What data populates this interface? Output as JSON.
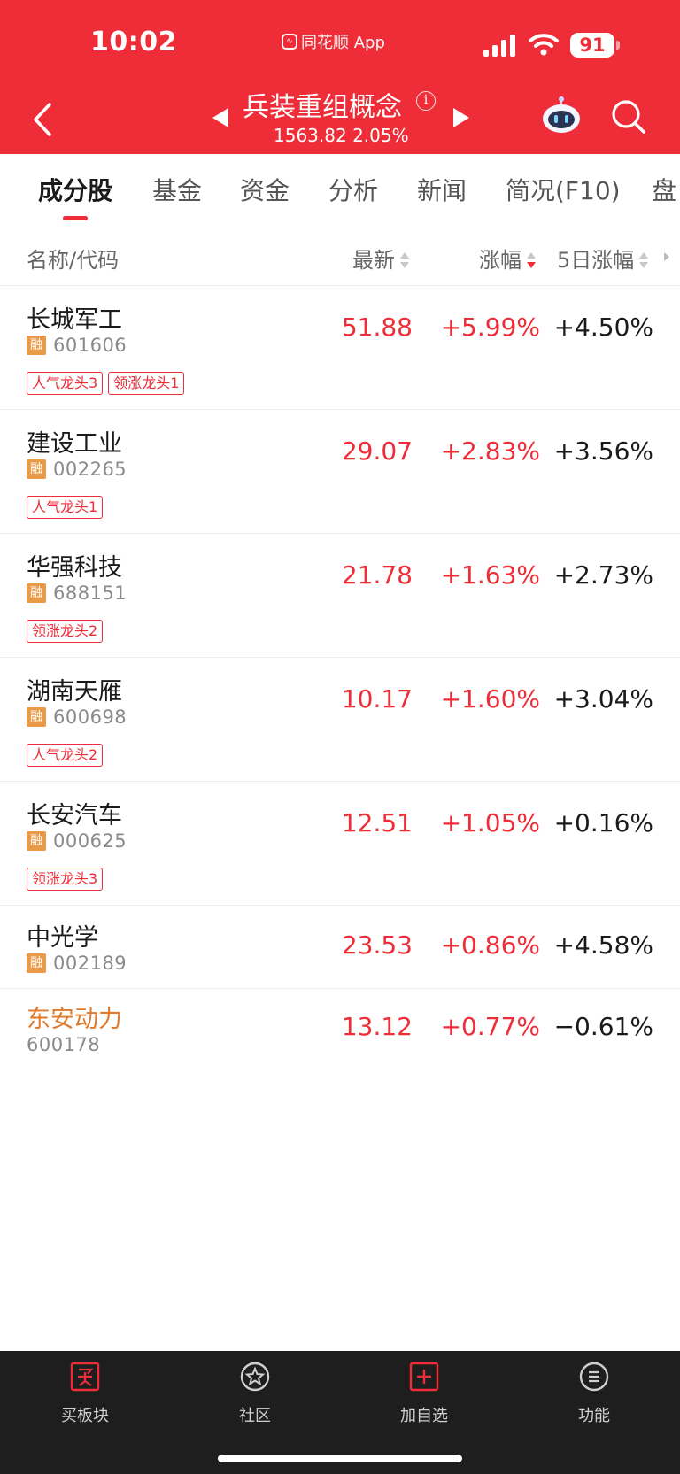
{
  "status_bar": {
    "time": "10:02",
    "app_label": "同花顺 App",
    "battery": "91"
  },
  "header": {
    "title": "兵装重组概念",
    "subtitle": "1563.82 2.05%"
  },
  "tabs": [
    "成分股",
    "基金",
    "资金",
    "分析",
    "新闻",
    "简况(F10)",
    "盘"
  ],
  "columns": {
    "name": "名称/代码",
    "price": "最新",
    "change": "涨幅",
    "change5d": "5日涨幅"
  },
  "rows": [
    {
      "name": "长城军工",
      "code": "601606",
      "rong": "融",
      "price": "51.88",
      "change": "+5.99%",
      "change5d": "+4.50%",
      "tags": [
        "人气龙头3",
        "领涨龙头1"
      ]
    },
    {
      "name": "建设工业",
      "code": "002265",
      "rong": "融",
      "price": "29.07",
      "change": "+2.83%",
      "change5d": "+3.56%",
      "tags": [
        "人气龙头1"
      ]
    },
    {
      "name": "华强科技",
      "code": "688151",
      "rong": "融",
      "price": "21.78",
      "change": "+1.63%",
      "change5d": "+2.73%",
      "tags": [
        "领涨龙头2"
      ]
    },
    {
      "name": "湖南天雁",
      "code": "600698",
      "rong": "融",
      "price": "10.17",
      "change": "+1.60%",
      "change5d": "+3.04%",
      "tags": [
        "人气龙头2"
      ]
    },
    {
      "name": "长安汽车",
      "code": "000625",
      "rong": "融",
      "price": "12.51",
      "change": "+1.05%",
      "change5d": "+0.16%",
      "tags": [
        "领涨龙头3"
      ]
    },
    {
      "name": "中光学",
      "code": "002189",
      "rong": "融",
      "price": "23.53",
      "change": "+0.86%",
      "change5d": "+4.58%",
      "tags": []
    },
    {
      "name": "东安动力",
      "code": "600178",
      "rong": "",
      "price": "13.12",
      "change": "+0.77%",
      "change5d": "−0.61%",
      "tags": []
    }
  ],
  "bottom_nav": [
    "买板块",
    "社区",
    "加自选",
    "功能"
  ],
  "colors": {
    "brand_red": "#ef2d38",
    "rong_orange": "#e89a48",
    "highlight_name": "#e07a2c"
  }
}
